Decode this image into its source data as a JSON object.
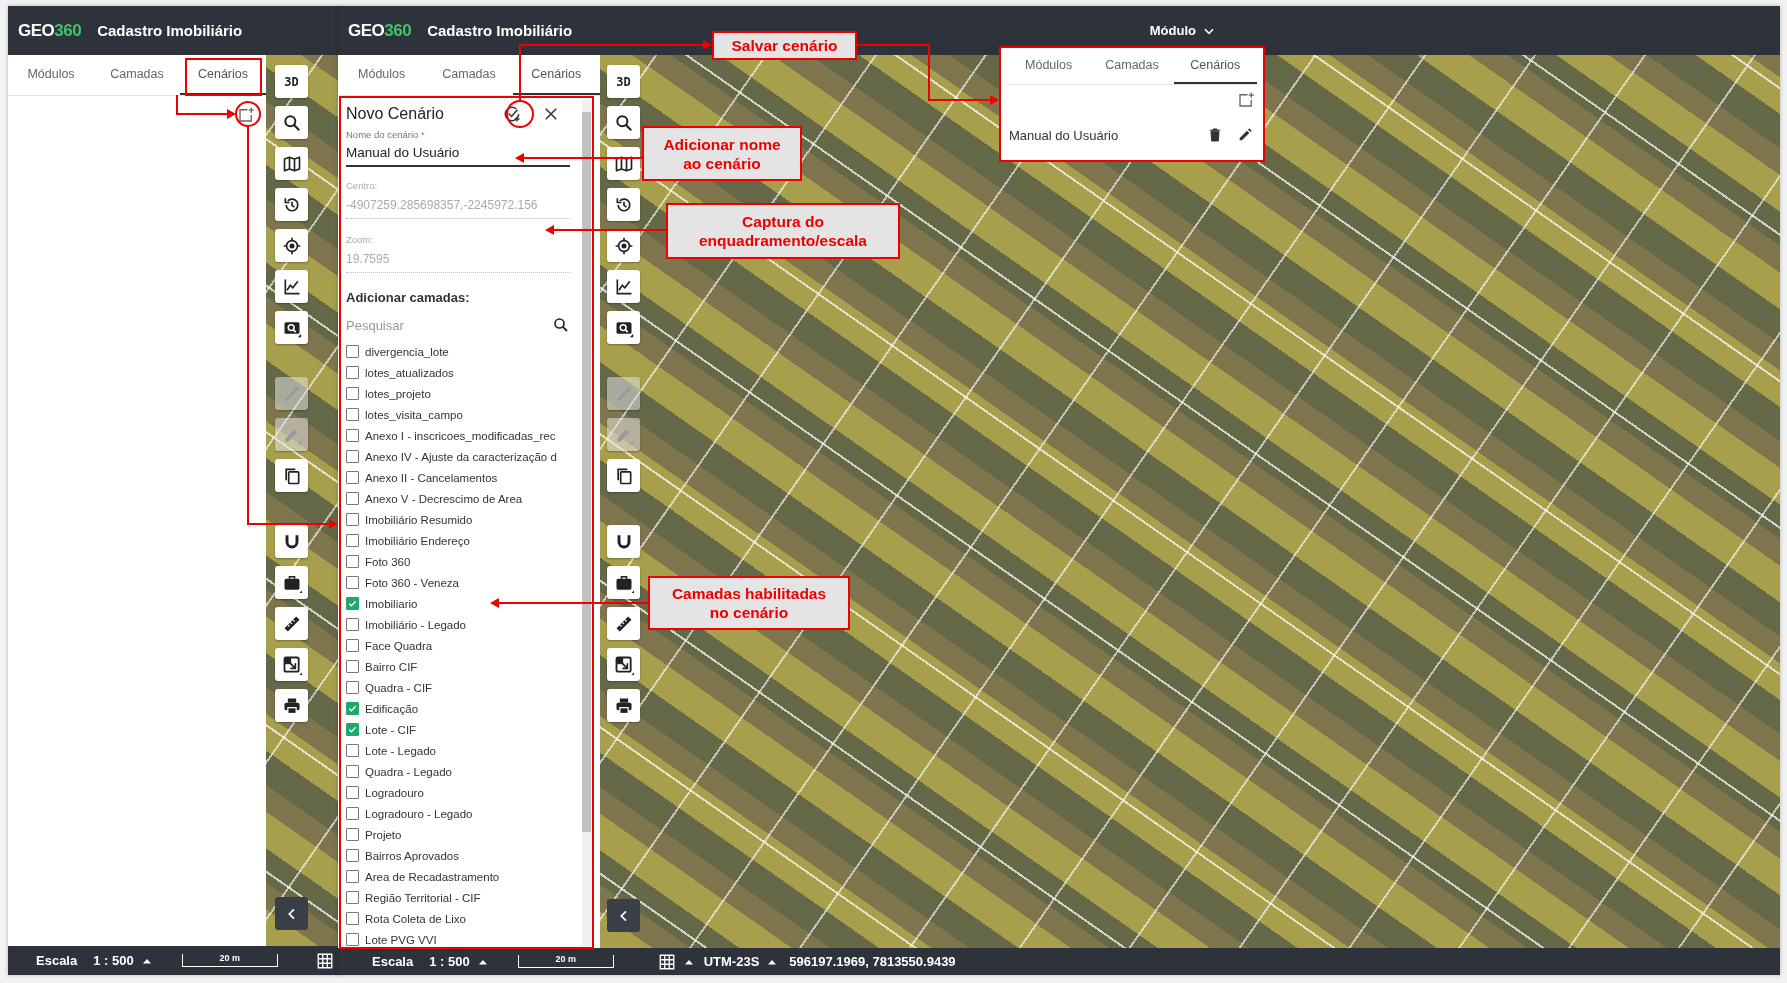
{
  "back_screen": {
    "header": {
      "logo": {
        "main": "GEO",
        "accent": "360"
      },
      "app_title": "Cadastro Imobiliário"
    },
    "tabs": [
      {
        "label": "Módulos",
        "selected": false
      },
      {
        "label": "Camadas",
        "selected": false
      },
      {
        "label": "Cenários",
        "selected": true
      }
    ],
    "toolbar": {
      "groups": [
        [
          {
            "kind": "text",
            "label": "3D",
            "disabled": false
          },
          {
            "kind": "search",
            "disabled": false
          },
          {
            "kind": "map",
            "disabled": false
          },
          {
            "kind": "history",
            "disabled": false
          },
          {
            "kind": "locate",
            "disabled": false
          },
          {
            "kind": "chart",
            "disabled": false
          },
          {
            "kind": "zoombox",
            "disabled": false
          }
        ],
        [
          {
            "kind": "draw",
            "disabled": true
          },
          {
            "kind": "edit",
            "disabled": true
          },
          {
            "kind": "copy",
            "disabled": false
          }
        ],
        [
          {
            "kind": "magnet",
            "disabled": false
          },
          {
            "kind": "briefcase",
            "disabled": false
          },
          {
            "kind": "ruler",
            "disabled": false
          },
          {
            "kind": "export",
            "disabled": false
          },
          {
            "kind": "print",
            "disabled": false
          }
        ]
      ]
    },
    "status_bar": {
      "scale_label": "Escala",
      "scale_value": "1 : 500",
      "scale_bar": "20 m"
    }
  },
  "front_screen": {
    "header": {
      "logo": {
        "main": "GEO",
        "accent": "360"
      },
      "app_title": "Cadastro Imobiliário",
      "module_menu": "Módulo"
    },
    "tabs": [
      {
        "label": "Módulos",
        "selected": false
      },
      {
        "label": "Camadas",
        "selected": false
      },
      {
        "label": "Cenários",
        "selected": true
      }
    ],
    "form": {
      "title": "Novo Cenário",
      "name_label": "Nome do cenário",
      "required_mark": "*",
      "name_value": "Manual do Usuário",
      "center_label": "Centro:",
      "center_value": "-4907259.285698357,-2245972.156",
      "zoom_label": "Zoom:",
      "zoom_value": "19.7595",
      "layers_heading": "Adicionar camadas:",
      "search_placeholder": "Pesquisar",
      "layers": [
        {
          "label": "divergencia_lote",
          "checked": false
        },
        {
          "label": "lotes_atualizados",
          "checked": false
        },
        {
          "label": "lotes_projeto",
          "checked": false
        },
        {
          "label": "lotes_visita_campo",
          "checked": false
        },
        {
          "label": "Anexo I - inscricoes_modificadas_rec",
          "checked": false
        },
        {
          "label": "Anexo IV - Ajuste da caracterização d",
          "checked": false
        },
        {
          "label": "Anexo II - Cancelamentos",
          "checked": false
        },
        {
          "label": "Anexo V - Decrescimo de Area",
          "checked": false
        },
        {
          "label": "Imobiliário Resumido",
          "checked": false
        },
        {
          "label": "Imobiliário Endereço",
          "checked": false
        },
        {
          "label": "Foto 360",
          "checked": false
        },
        {
          "label": "Foto 360 - Veneza",
          "checked": false
        },
        {
          "label": "Imobiliario",
          "checked": true
        },
        {
          "label": "Imobiliário - Legado",
          "checked": false
        },
        {
          "label": "Face Quadra",
          "checked": false
        },
        {
          "label": "Bairro CIF",
          "checked": false
        },
        {
          "label": "Quadra - CIF",
          "checked": false
        },
        {
          "label": "Edificação",
          "checked": true
        },
        {
          "label": "Lote - CIF",
          "checked": true
        },
        {
          "label": "Lote - Legado",
          "checked": false
        },
        {
          "label": "Quadra - Legado",
          "checked": false
        },
        {
          "label": "Logradouro",
          "checked": false
        },
        {
          "label": "Logradouro - Legado",
          "checked": false
        },
        {
          "label": "Projeto",
          "checked": false
        },
        {
          "label": "Bairros Aprovados",
          "checked": false
        },
        {
          "label": "Area de Recadastramento",
          "checked": false
        },
        {
          "label": "Região Territorial - CIF",
          "checked": false
        },
        {
          "label": "Rota Coleta de Lixo",
          "checked": false
        },
        {
          "label": "Lote PVG VVI",
          "checked": false
        }
      ]
    },
    "toolbar": {
      "groups": [
        [
          {
            "kind": "text",
            "label": "3D",
            "disabled": false
          },
          {
            "kind": "search",
            "disabled": false
          },
          {
            "kind": "map",
            "disabled": false
          },
          {
            "kind": "history",
            "disabled": false
          },
          {
            "kind": "locate",
            "disabled": false
          },
          {
            "kind": "chart",
            "disabled": false
          },
          {
            "kind": "zoombox",
            "disabled": false
          }
        ],
        [
          {
            "kind": "draw",
            "disabled": true
          },
          {
            "kind": "edit",
            "disabled": true
          },
          {
            "kind": "copy",
            "disabled": false
          }
        ],
        [
          {
            "kind": "magnet",
            "disabled": false
          },
          {
            "kind": "briefcase",
            "disabled": false
          },
          {
            "kind": "ruler",
            "disabled": false
          },
          {
            "kind": "export",
            "disabled": false
          },
          {
            "kind": "print",
            "disabled": false
          }
        ]
      ]
    },
    "status_bar": {
      "scale_label": "Escala",
      "scale_value": "1 : 500",
      "scale_bar": "20 m",
      "projection": "UTM-23S",
      "coordinates": "596197.1969, 7813550.9439"
    }
  },
  "popup": {
    "tabs": [
      {
        "label": "Módulos",
        "selected": false
      },
      {
        "label": "Camadas",
        "selected": false
      },
      {
        "label": "Cenários",
        "selected": true
      }
    ],
    "scenarios": [
      {
        "name": "Manual do Usuário"
      }
    ]
  },
  "callouts": [
    {
      "lines": [
        "Salvar cenário"
      ]
    },
    {
      "lines": [
        "Adicionar nome",
        "ao cenário"
      ]
    },
    {
      "lines": [
        "Captura do",
        "enquadramento/escala"
      ]
    },
    {
      "lines": [
        "Camadas habilitadas",
        "no cenário"
      ]
    }
  ]
}
